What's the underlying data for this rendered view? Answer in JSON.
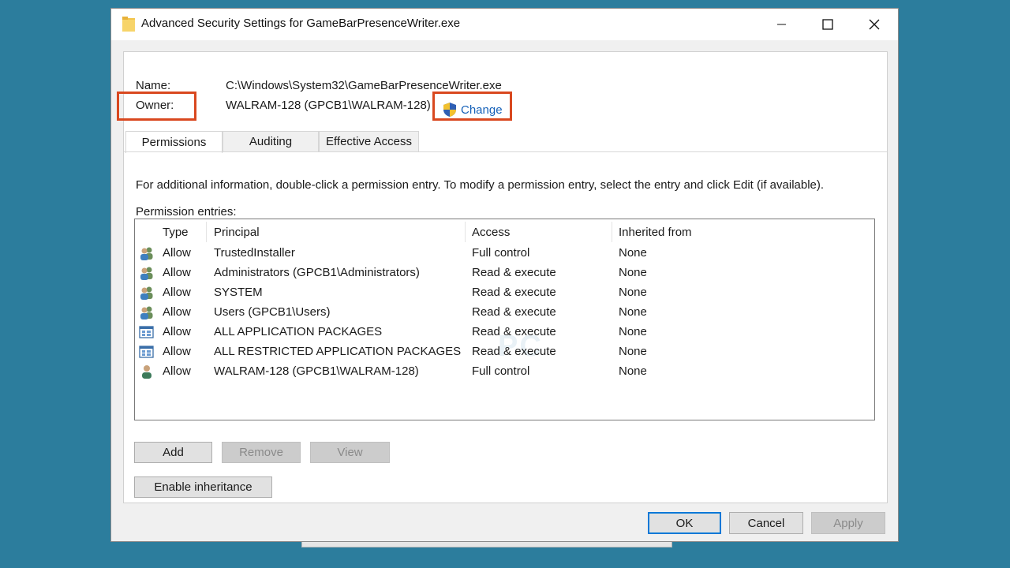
{
  "window": {
    "title": "Advanced Security Settings for GameBarPresenceWriter.exe"
  },
  "info": {
    "name_label": "Name:",
    "name_value": "C:\\Windows\\System32\\GameBarPresenceWriter.exe",
    "owner_label": "Owner:",
    "owner_value": "WALRAM-128 (GPCB1\\WALRAM-128)",
    "change_label": "Change"
  },
  "tabs": [
    {
      "label": "Permissions",
      "active": true
    },
    {
      "label": "Auditing",
      "active": false
    },
    {
      "label": "Effective Access",
      "active": false
    }
  ],
  "instructions": "For additional information, double-click a permission entry. To modify a permission entry, select the entry and click Edit (if available).",
  "entries_label": "Permission entries:",
  "columns": [
    "Type",
    "Principal",
    "Access",
    "Inherited from"
  ],
  "entries": [
    {
      "icon": "group-users-icon",
      "type": "Allow",
      "principal": "TrustedInstaller",
      "access": "Full control",
      "inherited": "None"
    },
    {
      "icon": "group-users-icon",
      "type": "Allow",
      "principal": "Administrators (GPCB1\\Administrators)",
      "access": "Read & execute",
      "inherited": "None"
    },
    {
      "icon": "group-users-icon",
      "type": "Allow",
      "principal": "SYSTEM",
      "access": "Read & execute",
      "inherited": "None"
    },
    {
      "icon": "group-users-icon",
      "type": "Allow",
      "principal": "Users (GPCB1\\Users)",
      "access": "Read & execute",
      "inherited": "None"
    },
    {
      "icon": "app-package-icon",
      "type": "Allow",
      "principal": "ALL APPLICATION PACKAGES",
      "access": "Read & execute",
      "inherited": "None"
    },
    {
      "icon": "app-package-icon",
      "type": "Allow",
      "principal": "ALL RESTRICTED APPLICATION PACKAGES",
      "access": "Read & execute",
      "inherited": "None"
    },
    {
      "icon": "single-user-icon",
      "type": "Allow",
      "principal": "WALRAM-128 (GPCB1\\WALRAM-128)",
      "access": "Full control",
      "inherited": "None"
    }
  ],
  "buttons": {
    "add": "Add",
    "remove": "Remove",
    "view": "View",
    "enable_inheritance": "Enable inheritance",
    "ok": "OK",
    "cancel": "Cancel",
    "apply": "Apply"
  },
  "colors": {
    "desktop": "#2c7d9d",
    "highlight": "#d9481f",
    "link": "#1460b8",
    "focus": "#0078d7"
  }
}
